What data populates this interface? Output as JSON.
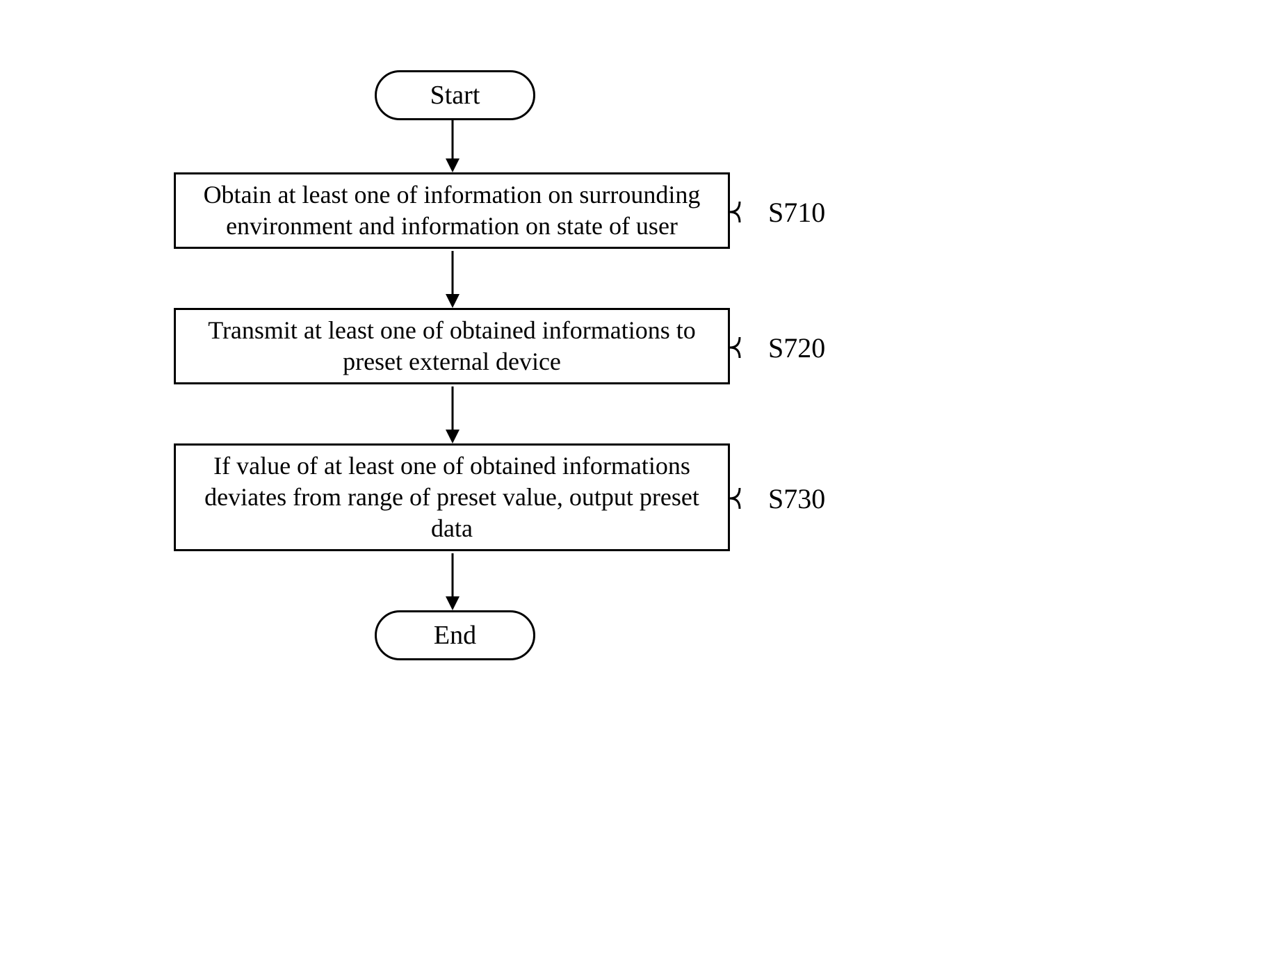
{
  "flow": {
    "start": "Start",
    "end": "End",
    "steps": [
      {
        "id": "S710",
        "text": "Obtain at least one of information on surrounding environment and information on state of user"
      },
      {
        "id": "S720",
        "text": "Transmit at least one of obtained informations to preset external device"
      },
      {
        "id": "S730",
        "text": "If value of at least one of obtained informations deviates from range of preset value, output preset data"
      }
    ]
  },
  "chart_data": {
    "type": "flowchart",
    "nodes": [
      {
        "id": "start",
        "shape": "terminal",
        "label": "Start"
      },
      {
        "id": "S710",
        "shape": "process",
        "label": "Obtain at least one of information on surrounding environment and information on state of user"
      },
      {
        "id": "S720",
        "shape": "process",
        "label": "Transmit at least one of obtained informations to preset external device"
      },
      {
        "id": "S730",
        "shape": "process",
        "label": "If value of at least one of obtained informations deviates from range of preset value, output preset data"
      },
      {
        "id": "end",
        "shape": "terminal",
        "label": "End"
      }
    ],
    "edges": [
      {
        "from": "start",
        "to": "S710"
      },
      {
        "from": "S710",
        "to": "S720"
      },
      {
        "from": "S720",
        "to": "S730"
      },
      {
        "from": "S730",
        "to": "end"
      }
    ]
  }
}
